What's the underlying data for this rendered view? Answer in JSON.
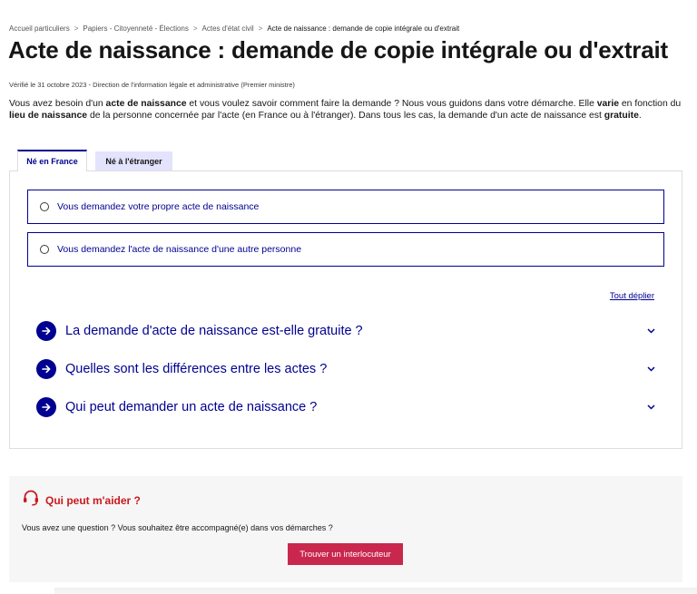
{
  "breadcrumb": {
    "items": [
      "Accueil particuliers",
      "Papiers - Citoyenneté - Élections",
      "Actes d'état civil"
    ],
    "current": "Acte de naissance : demande de copie intégrale ou d'extrait",
    "separator": ">"
  },
  "page": {
    "title": "Acte de naissance : demande de copie intégrale ou d'extrait",
    "verified": "Vérifié le 31 octobre 2023 - Direction de l'information légale et administrative (Premier ministre)",
    "intro": {
      "p1": "Vous avez besoin d'un ",
      "b1": "acte de naissance",
      "p2": " et vous voulez savoir comment faire la demande ? Nous vous guidons dans votre démarche. Elle ",
      "b2": "varie",
      "p3": " en fonction du ",
      "b3": "lieu de naissance",
      "p4": " de la personne concernée par l'acte (en France ou à l'étranger). Dans tous les cas, la demande d'un acte de naissance est ",
      "b4": "gratuite",
      "p5": "."
    }
  },
  "tabs": [
    {
      "label": "Né en France",
      "active": true
    },
    {
      "label": "Né à l'étranger",
      "active": false
    }
  ],
  "choices": [
    "Vous demandez votre propre acte de naissance",
    "Vous demandez l'acte de naissance d'une autre personne"
  ],
  "expand_all": "Tout déplier",
  "accordions": [
    "La demande d'acte de naissance est-elle gratuite ?",
    "Quelles sont les différences entre les actes ?",
    "Qui peut demander un acte de naissance ?"
  ],
  "help": {
    "title": "Qui peut m'aider ?",
    "text": "Vous avez une question ? Vous souhaitez être accompagné(e) dans vos démarches ?",
    "button": "Trouver un interlocuteur",
    "icon": "headset-icon"
  },
  "colors": {
    "primary_blue": "#000091",
    "tab_inactive_bg": "#e3e3fd",
    "help_accent": "#c9191e",
    "help_button": "#c9274e"
  }
}
